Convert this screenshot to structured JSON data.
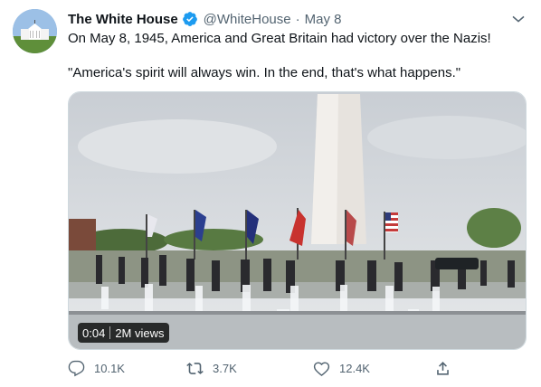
{
  "tweet": {
    "author_name": "The White House",
    "handle": "@WhiteHouse",
    "separator": "·",
    "date": "May 8",
    "line1": "On May 8, 1945, America and Great Britain had victory over the Nazis!",
    "line2": "\"America's spirit will always win. In the end, that's what happens.\""
  },
  "video": {
    "duration": "0:04",
    "views": "2M views"
  },
  "actions": {
    "replies": "10.1K",
    "retweets": "3.7K",
    "likes": "12.4K"
  },
  "colors": {
    "verified": "#1d9bf0",
    "muted": "#536471",
    "text": "#0f1419"
  },
  "icons": [
    "verified-badge-icon",
    "chevron-down-icon",
    "reply-icon",
    "retweet-icon",
    "like-icon",
    "share-icon"
  ]
}
